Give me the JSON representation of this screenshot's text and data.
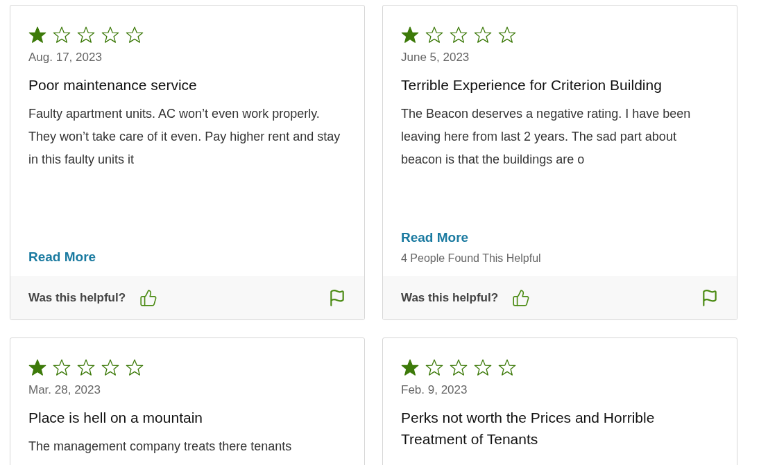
{
  "reviews": [
    {
      "stars": 1,
      "date": "Aug. 17, 2023",
      "title": "Poor maintenance service",
      "body": "Faulty apartment units. AC won’t even work properly. They won’t take care of it even. Pay higher rent and stay in this faulty units it",
      "read_more": "Read More",
      "footer": {
        "question": "Was this helpful?"
      }
    },
    {
      "stars": 1,
      "date": "June 5, 2023",
      "title": "Terrible Experience for Criterion Building",
      "body": "The Beacon deserves a negative rating. I have been leaving here from last 2 years. The sad part about beacon is that the buildings are o",
      "read_more": "Read More",
      "helpful_count": "4 People Found This Helpful",
      "footer": {
        "question": "Was this helpful?"
      }
    },
    {
      "stars": 1,
      "date": "Mar. 28, 2023",
      "title": "Place is hell on a mountain",
      "body": "The management company treats there tenants"
    },
    {
      "stars": 1,
      "date": "Feb. 9, 2023",
      "title": "Perks not worth the Prices and Horrible Treatment of Tenants"
    }
  ]
}
